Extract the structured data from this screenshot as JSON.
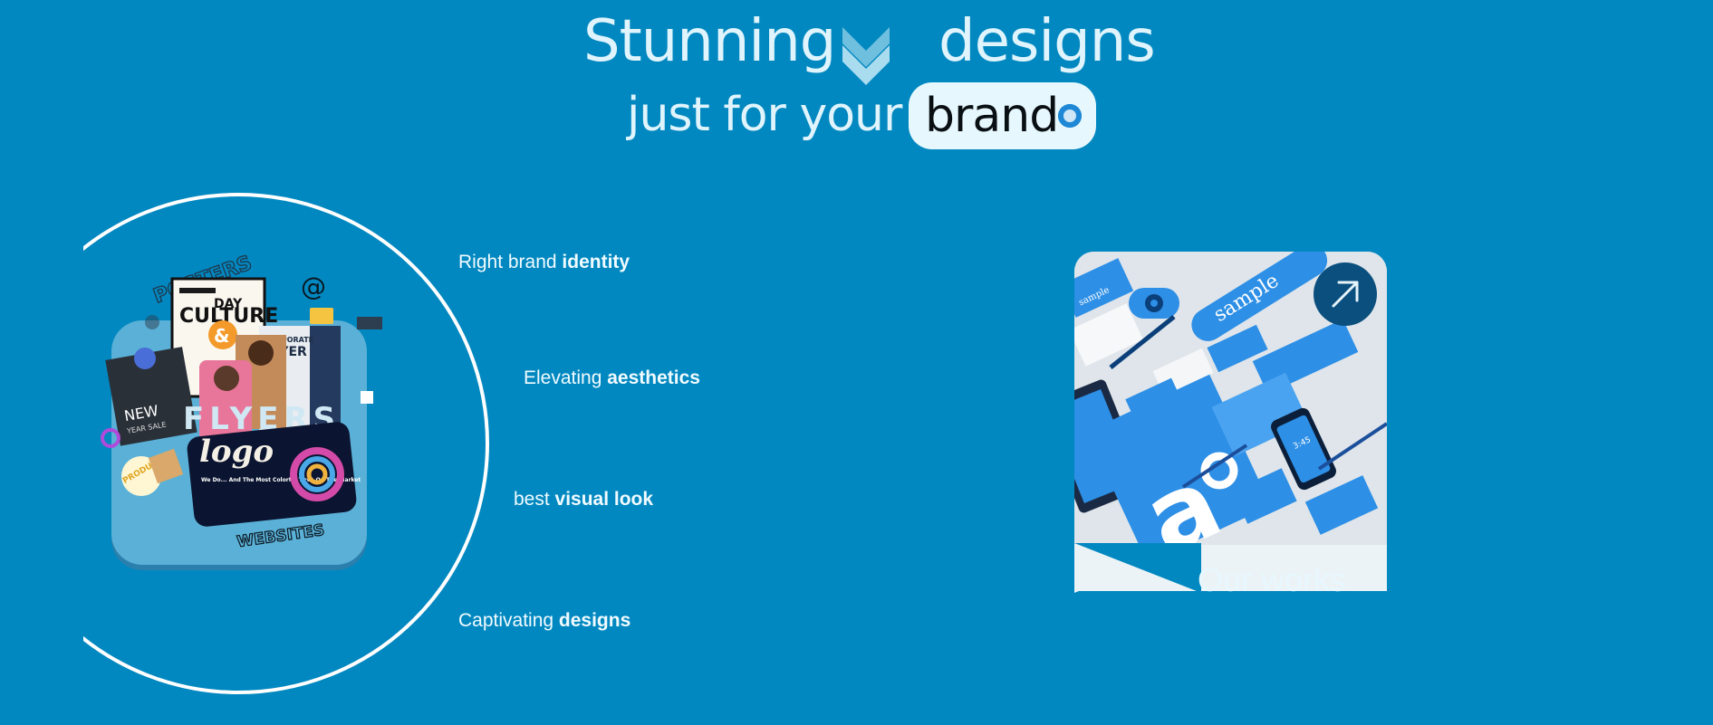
{
  "hero": {
    "word_stunning": "Stunning",
    "word_designs": "designs",
    "line2_prefix": "just for your",
    "brand_word": "brand"
  },
  "collage": {
    "poster_text": "POSTERS",
    "culture_text": "CULTURE",
    "day_text": "DAY",
    "corporate_text": "CORPORATE",
    "flyer_text": "FLYER",
    "new_text": "NEW",
    "year_sale_text": "YEAR SALE",
    "flyers_text": "FLYERS",
    "logo_text": "logo",
    "product_text": "PRODUC",
    "websites_text": "WEBSITES",
    "tagline_text": "We Do... And The Most Colorful Tires On The Market"
  },
  "features": [
    {
      "plain": "Right brand ",
      "bold": "identity"
    },
    {
      "plain": "Elevating ",
      "bold": "aesthetics"
    },
    {
      "plain": "best ",
      "bold": "visual look"
    },
    {
      "plain": "Captivating ",
      "bold": "designs"
    }
  ],
  "works": {
    "label": "Our works",
    "sample_text": "sample",
    "phone_time": "3:45",
    "arrow_icon": "arrow-up-right-icon"
  },
  "colors": {
    "background": "#0288c0",
    "pill": "#e6f8fd",
    "arrow_circle": "#0a4f7e",
    "brand_blue": "#2196f3"
  }
}
